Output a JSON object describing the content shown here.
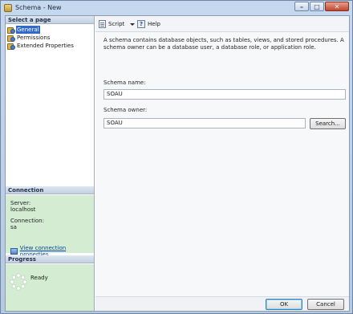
{
  "window": {
    "title": "Schema - New"
  },
  "window_buttons": {
    "minimize_glyph": "–",
    "maximize_glyph": "□",
    "close_glyph": "✕"
  },
  "left": {
    "select_page_header": "Select a page",
    "pages": [
      {
        "label": "General",
        "selected": true
      },
      {
        "label": "Permissions",
        "selected": false
      },
      {
        "label": "Extended Properties",
        "selected": false
      }
    ],
    "connection_header": "Connection",
    "server_label": "Server:",
    "server_value": "localhost",
    "connection_label": "Connection:",
    "connection_value": "sa",
    "view_connection_link": "View connection properties",
    "progress_header": "Progress",
    "progress_status": "Ready"
  },
  "toolbar": {
    "script_label": "Script",
    "help_label": "Help",
    "help_glyph": "?"
  },
  "main": {
    "description": "A schema contains database objects, such as tables, views, and stored procedures. A schema owner can be a database user, a database role, or application role.",
    "schema_name_label": "Schema name:",
    "schema_name_value": "SOAU",
    "schema_owner_label": "Schema owner:",
    "schema_owner_value": "SOAU",
    "search_button": "Search..."
  },
  "footer": {
    "ok_button": "OK",
    "cancel_button": "Cancel"
  },
  "colors": {
    "green_panel": "#d3ecd2",
    "selection": "#3169c6",
    "link": "#0a43a8"
  }
}
